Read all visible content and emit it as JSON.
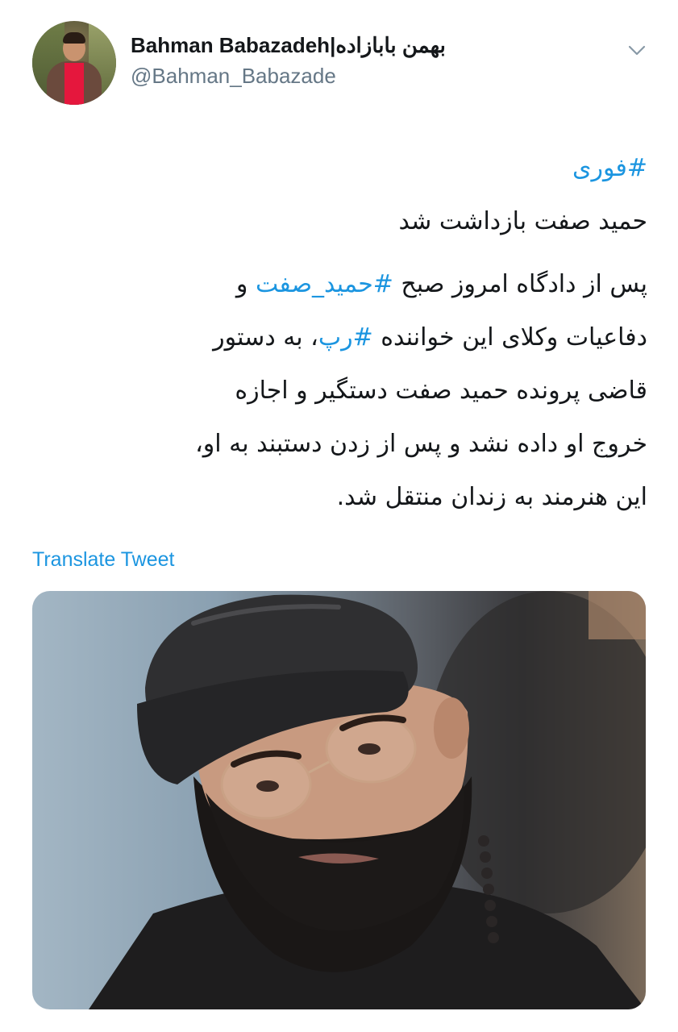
{
  "user": {
    "display_name": "Bahman Babazadeh|بهمن بابازاده",
    "handle": "@Bahman_Babazade",
    "avatar_icon": "profile-photo",
    "menu_icon": "chevron-down-icon"
  },
  "tweet": {
    "hashtag_line": "#فوری",
    "headline": "حمید صفت بازداشت شد",
    "para_line1_pre": "پس از دادگاه امروز صبح ",
    "para_line1_tag": "#حمید_صفت",
    "para_line1_post": " و",
    "para_line2_pre": "دفاعیات وکلای این خواننده ",
    "para_line2_tag": "#رپ",
    "para_line2_post": "، به دستور",
    "para_line3": "قاضی پرونده حمید صفت دستگیر و اجازه",
    "para_line4": "خروج او داده نشد و پس از زدن دستبند به او،",
    "para_line5": "این هنرمند به زندان منتقل شد."
  },
  "translate_label": "Translate Tweet",
  "colors": {
    "link": "#1b95e0",
    "text": "#14171a",
    "secondary": "#657786"
  },
  "media": {
    "type": "photo"
  }
}
